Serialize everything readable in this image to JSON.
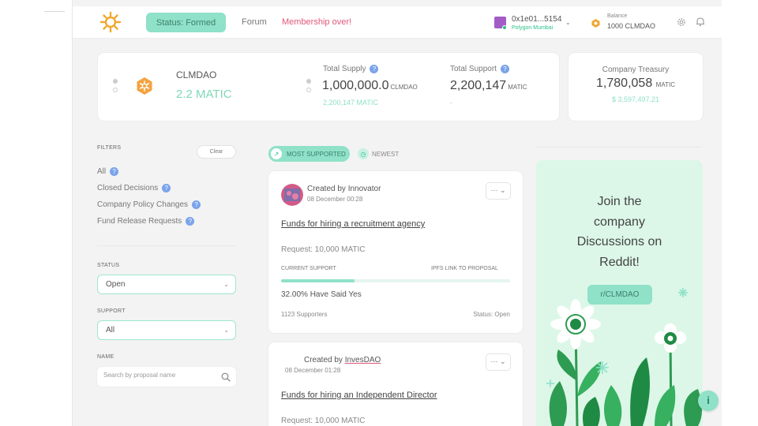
{
  "colors": {
    "accent": "#8fe1c8",
    "accent_dark": "#2cc38b",
    "alert": "#e0577a",
    "page_bg": "#f3f3f3"
  },
  "header": {
    "logo_icon": "sun-logo-icon",
    "status_label": "Status: Formed",
    "forum_label": "Forum",
    "membership_label": "Membership over!",
    "wallet": {
      "address": "0x1e01...5154",
      "network": "Polygon Mumbai"
    },
    "balance": {
      "label": "Balance",
      "value": "1000 CLMDAO"
    }
  },
  "dao": {
    "name": "CLMDAO",
    "amount": "2.2 MATIC"
  },
  "stats": {
    "total_supply": {
      "label": "Total Supply",
      "value": "1,000,000.0",
      "unit": "CLMDAO",
      "sub": "2,200,147 MATIC"
    },
    "total_support": {
      "label": "Total Support",
      "value": "2,200,147",
      "unit": "MATIC",
      "sub": "-"
    }
  },
  "treasury": {
    "label": "Company Treasury",
    "value": "1,780,058",
    "unit": "MATIC",
    "usd": "$ 3,597,497.21"
  },
  "filters": {
    "title": "FILTERS",
    "clear_label": "Clear",
    "items": [
      {
        "label": "All"
      },
      {
        "label": "Closed Decisions"
      },
      {
        "label": "Company Policy Changes"
      },
      {
        "label": "Fund Release Requests"
      }
    ],
    "status": {
      "label": "STATUS",
      "value": "Open"
    },
    "support": {
      "label": "SUPPORT",
      "value": "All"
    },
    "name": {
      "label": "NAME",
      "placeholder": "Search by proposal name"
    }
  },
  "tabs": {
    "active": "MOST SUPPORTED",
    "other": "NEWEST"
  },
  "proposals": [
    {
      "created_prefix": "Created by",
      "creator": "Innovator",
      "date": "08 December 00:28",
      "title": "Funds for hiring a recruitment agency",
      "request": "Request:  10,000 MATIC",
      "current_support_label": "CURRENT SUPPORT",
      "ipfs_label": "IPFS LINK TO PROPOSAL",
      "support_fraction": 0.32,
      "said_yes": "32.00% Have Said Yes",
      "supporters": "1123 Supporters",
      "status": "Status: Open"
    },
    {
      "created_prefix": "Created by",
      "creator": "InvesDAO",
      "date": "08 December 01:28",
      "title": "Funds for hiring an Independent Director",
      "request": "Request:  10,000 MATIC"
    }
  ],
  "menu_glyph": "··· ⌄",
  "promo": {
    "line1": "Join the",
    "line2": "company",
    "line3": "Discussions on",
    "line4": "Reddit!",
    "button": "r/CLMDAO"
  },
  "help_glyph": "i"
}
